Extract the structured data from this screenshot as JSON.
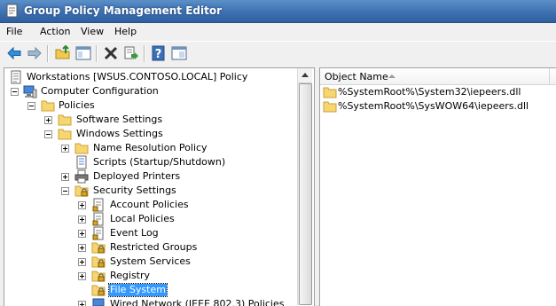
{
  "window": {
    "title": "Group Policy Management Editor",
    "icon": "gpme-app-icon"
  },
  "menu": [
    "File",
    "Action",
    "View",
    "Help"
  ],
  "toolbar": [
    {
      "name": "back-icon"
    },
    {
      "name": "forward-icon"
    },
    {
      "name": "up-folder-icon"
    },
    {
      "name": "show-hide-tree-icon"
    },
    {
      "name": "delete-icon"
    },
    {
      "name": "export-list-icon"
    },
    {
      "name": "help-icon"
    },
    {
      "name": "properties-icon"
    }
  ],
  "tree": [
    {
      "label": "Workstations [WSUS.CONTOSO.LOCAL] Policy",
      "icon": "policy-document-icon"
    },
    {
      "label": "Computer Configuration",
      "icon": "computer-icon",
      "expander": "minus"
    },
    {
      "label": "Policies",
      "icon": "folder-icon",
      "expander": "minus"
    },
    {
      "label": "Software Settings",
      "icon": "folder-icon",
      "expander": "plus"
    },
    {
      "label": "Windows Settings",
      "icon": "folder-icon",
      "expander": "minus"
    },
    {
      "label": "Name Resolution Policy",
      "icon": "folder-icon",
      "expander": "plus"
    },
    {
      "label": "Scripts (Startup/Shutdown)",
      "icon": "scripts-icon"
    },
    {
      "label": "Deployed Printers",
      "icon": "printer-icon",
      "expander": "plus"
    },
    {
      "label": "Security Settings",
      "icon": "security-folder-icon",
      "expander": "minus"
    },
    {
      "label": "Account Policies",
      "icon": "policy-icon",
      "expander": "plus"
    },
    {
      "label": "Local Policies",
      "icon": "policy-icon",
      "expander": "plus"
    },
    {
      "label": "Event Log",
      "icon": "policy-icon",
      "expander": "plus"
    },
    {
      "label": "Restricted Groups",
      "icon": "security-folder-icon",
      "expander": "plus"
    },
    {
      "label": "System Services",
      "icon": "security-folder-icon",
      "expander": "plus"
    },
    {
      "label": "Registry",
      "icon": "security-folder-icon",
      "expander": "plus"
    },
    {
      "label": "File System",
      "icon": "security-folder-icon",
      "selected": true
    },
    {
      "label": "Wired Network (IEEE 802.3) Policies",
      "icon": "network-icon",
      "expander": "plus"
    }
  ],
  "list": {
    "column_header": "Object Name",
    "items": [
      {
        "label": "%SystemRoot%\\System32\\iepeers.dll",
        "icon": "folder-icon"
      },
      {
        "label": "%SystemRoot%\\SysWOW64\\iepeers.dll",
        "icon": "folder-icon"
      }
    ]
  },
  "colors": {
    "title_bar": "#3d6fb0",
    "selection": "#3399ff",
    "folder": "#f6d671"
  }
}
